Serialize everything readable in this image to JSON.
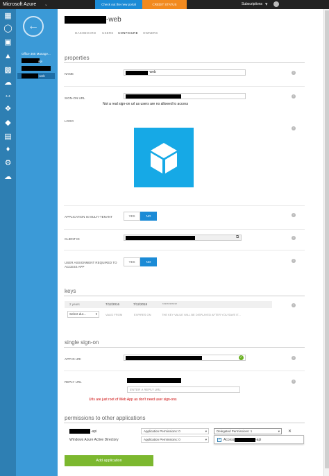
{
  "topbar": {
    "brand": "Microsoft Azure",
    "promo": "Check out the new portal",
    "credit": "CREDIT STATUS",
    "subscriptions": "Subscriptions"
  },
  "subnav": {
    "title": "Office 365 Manage...",
    "items": [
      "api",
      "-web"
    ]
  },
  "header": {
    "title_suffix": "-web",
    "tabs": [
      "DASHBOARD",
      "USERS",
      "CONFIGURE",
      "OWNERS"
    ],
    "active_tab": "CONFIGURE"
  },
  "properties": {
    "section_title": "properties",
    "name_label": "NAME",
    "name_value": "-web",
    "signon_label": "SIGN-ON URL",
    "signon_note": "Not a real sign-on url as users are no allowed to access",
    "logo_label": "LOGO",
    "multitenant_label": "APPLICATION IS MULTI-TENANT",
    "yes_label": "YES",
    "no_label": "NO",
    "clientid_label": "CLIENT ID",
    "userassign_label": "USER ASSIGNMENT REQUIRED TO ACCESS APP"
  },
  "keys": {
    "section_title": "keys",
    "row": {
      "duration": "2 years",
      "valid_from": "7/12/2016",
      "expires_on": "7/12/2018",
      "value": "************"
    },
    "select_placeholder": "Select dur...",
    "valid_from_hint": "VALID FROM",
    "expires_on_hint": "EXPIRES ON",
    "value_hint": "THE KEY VALUE WILL BE DISPLAYED AFTER YOU SAVE IT..."
  },
  "sso": {
    "section_title": "single sign-on",
    "appid_label": "APP ID URI",
    "reply_label": "REPLY URL",
    "reply_placeholder": "ENTER A REPLY URL",
    "reply_note": "Urls are just root of Web App as don't need user sign-ons"
  },
  "permissions": {
    "section_title": "permissions to other applications",
    "app1_suffix": "-api",
    "app2": "Windows Azure Active Directory",
    "app_perms_1": "Application Permissions: 0",
    "app_perms_2": "Application Permissions: 0",
    "delegated": "Delegated Permissions: 1",
    "dropdown_item_prefix": "Access",
    "dropdown_item_suffix": "-api",
    "add_button": "Add application"
  },
  "colors": {
    "rail": "#2e7fb3",
    "subnav": "#3b9ad7",
    "accent_blue": "#1b8bd6",
    "credit_orange": "#f28a1f",
    "logo_tile": "#16a9e6",
    "add_green": "#7cb82f",
    "note_red": "#cc0000"
  }
}
